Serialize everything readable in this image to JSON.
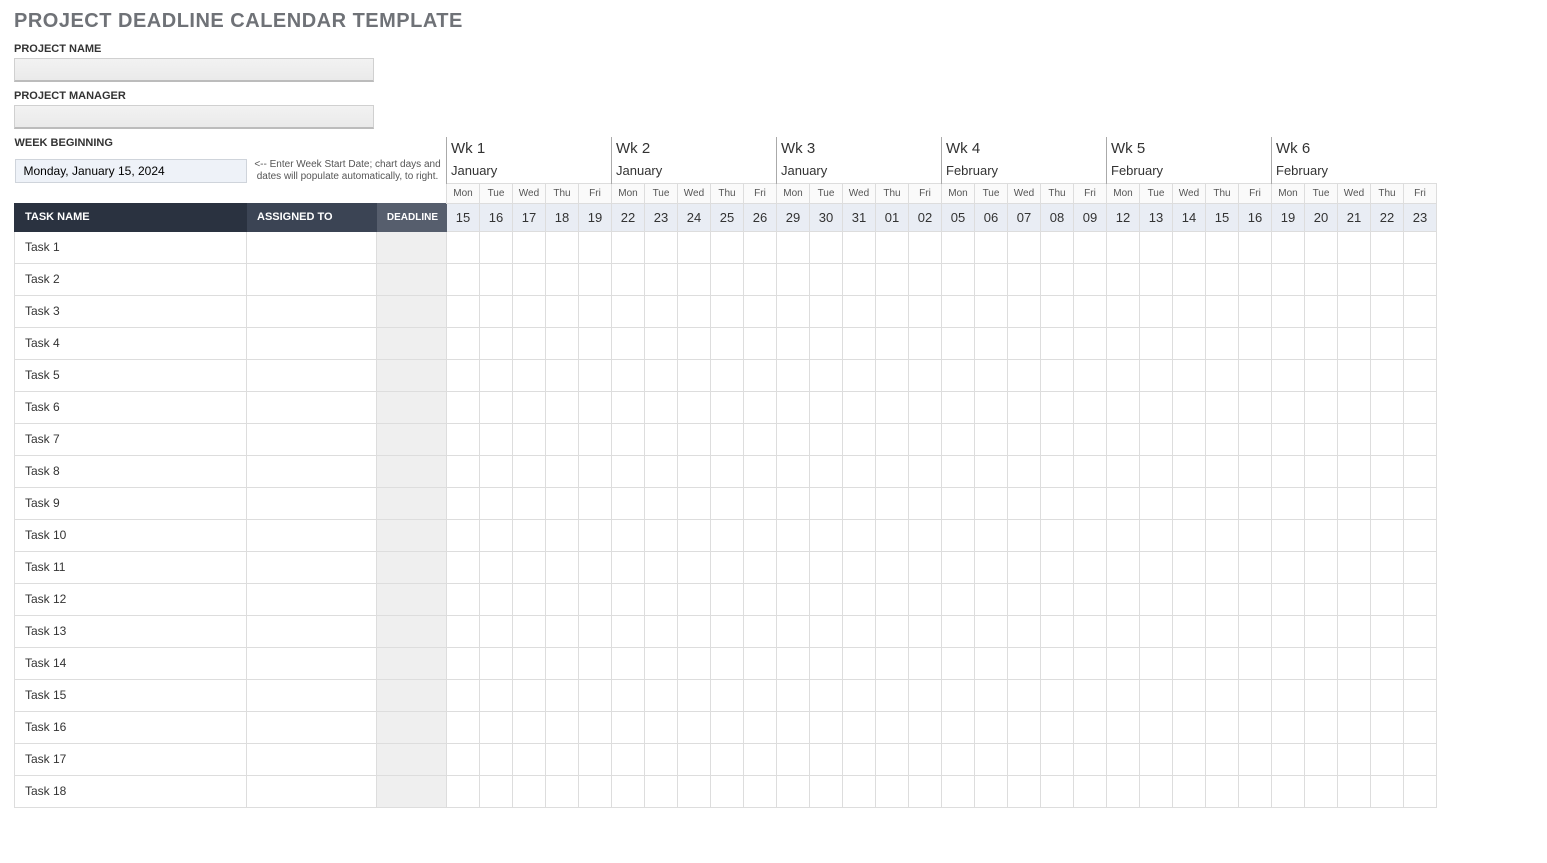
{
  "title": "PROJECT DEADLINE CALENDAR TEMPLATE",
  "labels": {
    "project_name": "PROJECT NAME",
    "project_manager": "PROJECT MANAGER",
    "week_beginning": "WEEK BEGINNING"
  },
  "inputs": {
    "project_name": "",
    "project_manager": "",
    "week_start_date": "Monday, January 15, 2024",
    "week_start_hint": "<-- Enter Week Start Date; chart days and dates will populate automatically, to right."
  },
  "columns": {
    "task_name": "TASK NAME",
    "assigned_to": "ASSIGNED TO",
    "deadline": "DEADLINE"
  },
  "weeks": [
    {
      "label": "Wk 1",
      "month": "January",
      "days": [
        "Mon",
        "Tue",
        "Wed",
        "Thu",
        "Fri"
      ],
      "dates": [
        "15",
        "16",
        "17",
        "18",
        "19"
      ]
    },
    {
      "label": "Wk 2",
      "month": "January",
      "days": [
        "Mon",
        "Tue",
        "Wed",
        "Thu",
        "Fri"
      ],
      "dates": [
        "22",
        "23",
        "24",
        "25",
        "26"
      ]
    },
    {
      "label": "Wk 3",
      "month": "January",
      "days": [
        "Mon",
        "Tue",
        "Wed",
        "Thu",
        "Fri"
      ],
      "dates": [
        "29",
        "30",
        "31",
        "01",
        "02"
      ]
    },
    {
      "label": "Wk 4",
      "month": "February",
      "days": [
        "Mon",
        "Tue",
        "Wed",
        "Thu",
        "Fri"
      ],
      "dates": [
        "05",
        "06",
        "07",
        "08",
        "09"
      ]
    },
    {
      "label": "Wk 5",
      "month": "February",
      "days": [
        "Mon",
        "Tue",
        "Wed",
        "Thu",
        "Fri"
      ],
      "dates": [
        "12",
        "13",
        "14",
        "15",
        "16"
      ]
    },
    {
      "label": "Wk 6",
      "month": "February",
      "days": [
        "Mon",
        "Tue",
        "Wed",
        "Thu",
        "Fri"
      ],
      "dates": [
        "19",
        "20",
        "21",
        "22",
        "23"
      ]
    }
  ],
  "tasks": [
    {
      "name": "Task 1",
      "assigned_to": "",
      "deadline": ""
    },
    {
      "name": "Task 2",
      "assigned_to": "",
      "deadline": ""
    },
    {
      "name": "Task 3",
      "assigned_to": "",
      "deadline": ""
    },
    {
      "name": "Task 4",
      "assigned_to": "",
      "deadline": ""
    },
    {
      "name": "Task 5",
      "assigned_to": "",
      "deadline": ""
    },
    {
      "name": "Task 6",
      "assigned_to": "",
      "deadline": ""
    },
    {
      "name": "Task 7",
      "assigned_to": "",
      "deadline": ""
    },
    {
      "name": "Task 8",
      "assigned_to": "",
      "deadline": ""
    },
    {
      "name": "Task 9",
      "assigned_to": "",
      "deadline": ""
    },
    {
      "name": "Task 10",
      "assigned_to": "",
      "deadline": ""
    },
    {
      "name": "Task 11",
      "assigned_to": "",
      "deadline": ""
    },
    {
      "name": "Task 12",
      "assigned_to": "",
      "deadline": ""
    },
    {
      "name": "Task 13",
      "assigned_to": "",
      "deadline": ""
    },
    {
      "name": "Task 14",
      "assigned_to": "",
      "deadline": ""
    },
    {
      "name": "Task 15",
      "assigned_to": "",
      "deadline": ""
    },
    {
      "name": "Task 16",
      "assigned_to": "",
      "deadline": ""
    },
    {
      "name": "Task 17",
      "assigned_to": "",
      "deadline": ""
    },
    {
      "name": "Task 18",
      "assigned_to": "",
      "deadline": ""
    }
  ]
}
